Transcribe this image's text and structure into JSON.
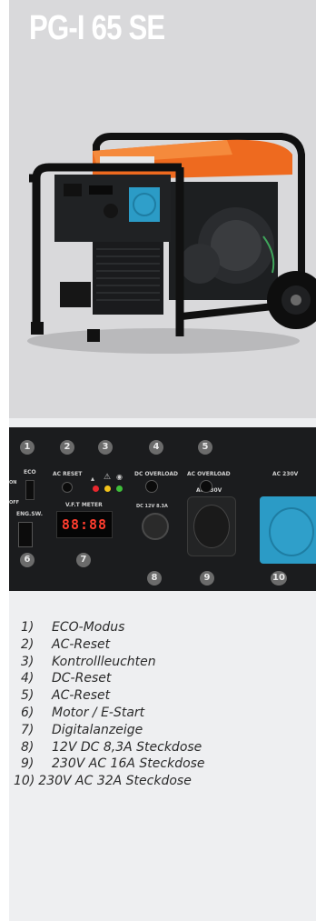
{
  "hero": {
    "title": "PG-I 65 SE",
    "product_image": "inverter-generator-photo"
  },
  "panel": {
    "callouts": [
      "1",
      "2",
      "3",
      "4",
      "5",
      "6",
      "7",
      "8",
      "9",
      "10"
    ],
    "labels": {
      "eco": "ECO",
      "ac_reset": "AC RESET",
      "dc_overload": "DC OVERLOAD",
      "ac_overload": "AC OVERLOAD",
      "ac_230v_top": "AC 230V",
      "eng_sw": "ENG.SW.",
      "vft_meter": "V.F.T METER",
      "dc_12v": "DC 12V 8.3A",
      "ac_230v": "AC 230V",
      "eco_on": "ON",
      "eco_off": "OFF"
    },
    "meter_value": "88:88",
    "led_colors": [
      "#e8282e",
      "#f2c21a",
      "#3fbf3a"
    ],
    "socket_color": "#2b9bc6"
  },
  "legend": {
    "items": [
      {
        "num": "1)",
        "text": "ECO-Modus"
      },
      {
        "num": "2)",
        "text": "AC-Reset"
      },
      {
        "num": "3)",
        "text": "Kontrollleuchten"
      },
      {
        "num": "4)",
        "text": "DC-Reset"
      },
      {
        "num": "5)",
        "text": "AC-Reset"
      },
      {
        "num": "6)",
        "text": "Motor / E-Start"
      },
      {
        "num": "7)",
        "text": "Digitalanzeige"
      },
      {
        "num": "8)",
        "text": "12V DC 8,3A Steckdose"
      },
      {
        "num": "9)",
        "text": "230V AC 16A Steckdose"
      },
      {
        "num": "10)",
        "text": "230V AC 32A Steckdose"
      }
    ]
  }
}
